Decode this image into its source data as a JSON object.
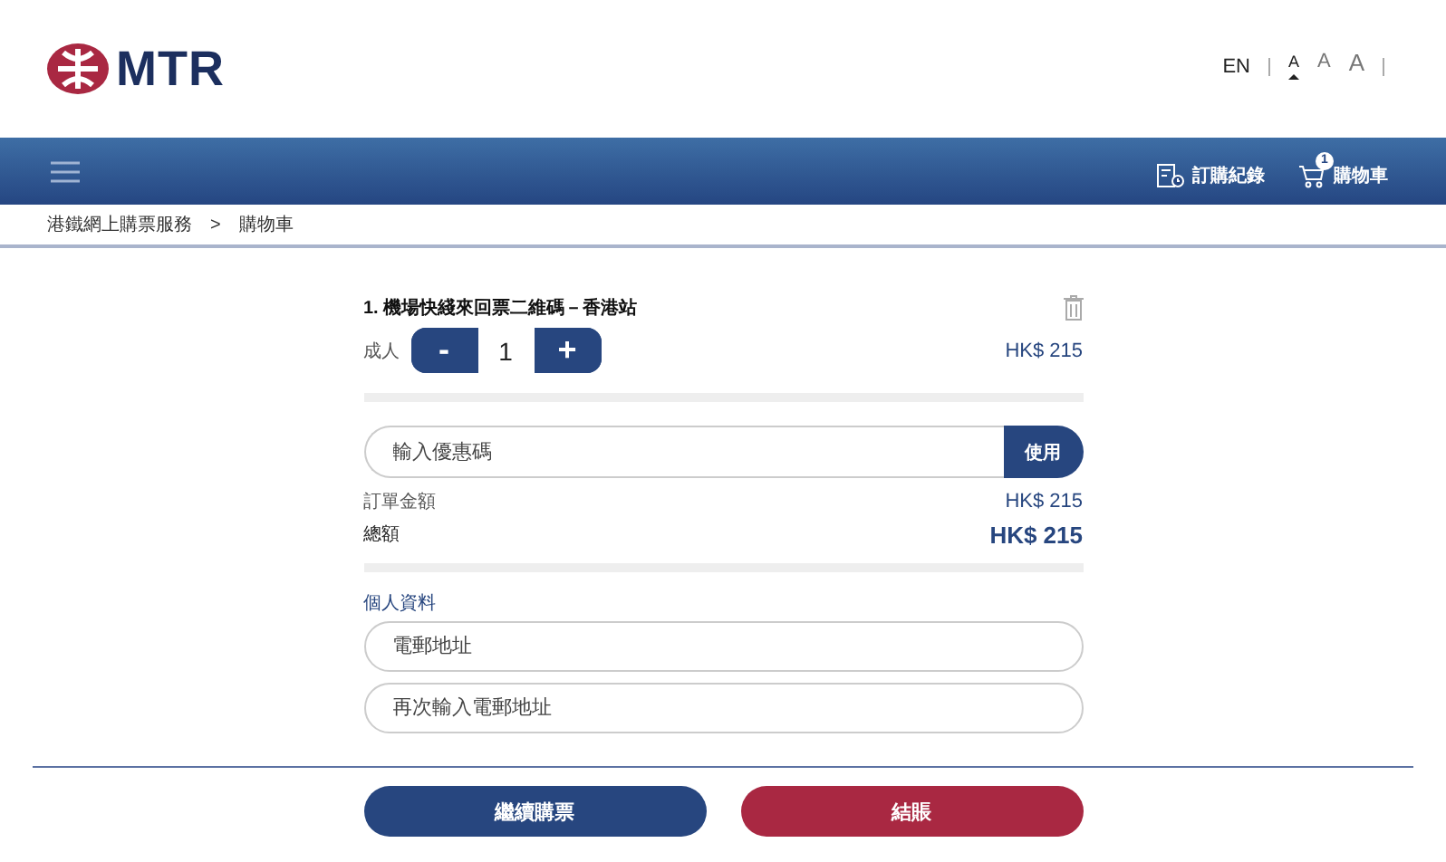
{
  "logo": {
    "text": "MTR"
  },
  "language": {
    "label": "EN"
  },
  "font_sizes": [
    {
      "label": "A",
      "selected": true
    },
    {
      "label": "A",
      "selected": false
    },
    {
      "label": "A",
      "selected": false
    }
  ],
  "nav": {
    "order_history": "訂購紀錄",
    "cart": {
      "label": "購物車",
      "count": "1"
    }
  },
  "breadcrumb": [
    "港鐵網上購票服務",
    ">",
    "購物車"
  ],
  "cart_items": [
    {
      "title": "1. 機場快綫來回票二維碼－香港站",
      "passenger_type": "成人",
      "decrease": "-",
      "quantity": "1",
      "increase": "+",
      "price": "HK$ 215"
    }
  ],
  "promo": {
    "placeholder": "輸入優惠碼",
    "button": "使用"
  },
  "summary": {
    "subtotal_label": "訂單金額",
    "subtotal": "HK$ 215",
    "total_label": "總額",
    "total": "HK$ 215"
  },
  "personal_info": {
    "heading": "個人資料",
    "fields": [
      {
        "placeholder": "電郵地址"
      },
      {
        "placeholder": "再次輸入電郵地址"
      }
    ]
  },
  "actions": [
    {
      "label": "繼續購票",
      "kind": "secondary"
    },
    {
      "label": "結賬",
      "kind": "primary"
    }
  ]
}
